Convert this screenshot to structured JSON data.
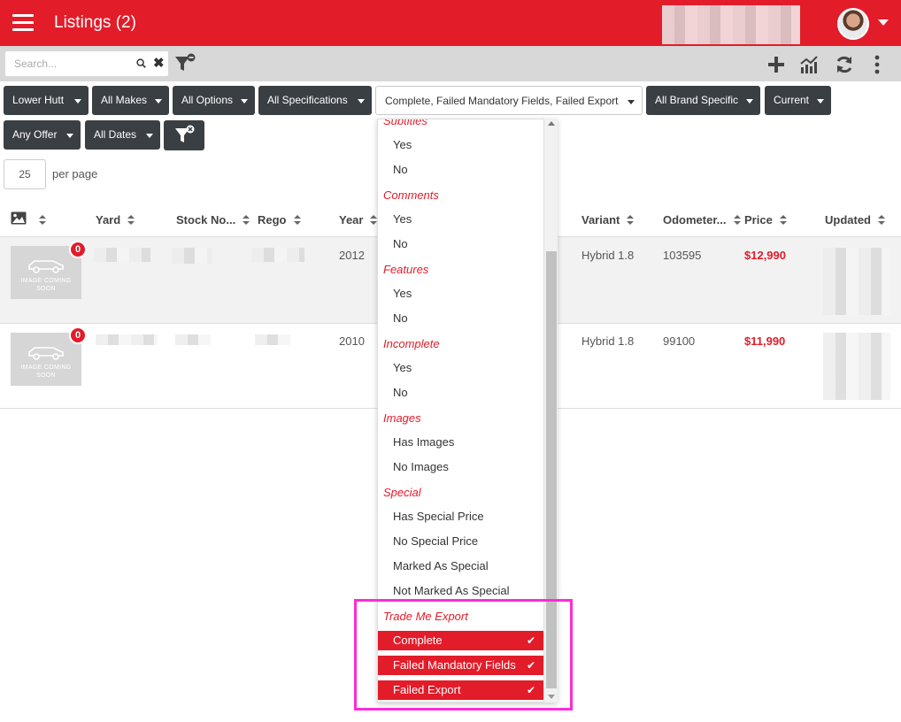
{
  "header": {
    "title": "Listings (2)",
    "accent_color": "#e31c2a"
  },
  "toolbar": {
    "search_placeholder": "Search...",
    "icons": [
      "search-icon",
      "clear-icon",
      "filter-clear-icon",
      "add-icon",
      "stats-icon",
      "refresh-icon",
      "more-vert-icon"
    ]
  },
  "filters": {
    "yard": "Lower Hutt",
    "makes": "All Makes",
    "options": "All Options",
    "specifications": "All Specifications",
    "export_status": "Complete,  Failed Mandatory Fields,  Failed Export",
    "brand_specific": "All Brand Specific",
    "status": "Current",
    "offer": "Any Offer",
    "dates": "All Dates"
  },
  "pagination": {
    "per_page_value": "25",
    "per_page_label": "per page"
  },
  "table": {
    "columns": [
      "Yard",
      "Stock No...",
      "Rego",
      "Year",
      "Variant",
      "Odometer...",
      "Price",
      "Updated"
    ],
    "rows": [
      {
        "badge": "0",
        "image_text": "IMAGE COMING SOON",
        "year": "2012",
        "variant": "Hybrid 1.8",
        "odometer": "103595",
        "price": "$12,990"
      },
      {
        "badge": "0",
        "image_text": "IMAGE COMING SOON",
        "year": "2010",
        "variant": "Hybrid 1.8",
        "odometer": "99100",
        "price": "$11,990"
      }
    ]
  },
  "dropdown": {
    "groups": [
      {
        "label": "Subtitles",
        "items": [
          "Yes",
          "No"
        ]
      },
      {
        "label": "Comments",
        "items": [
          "Yes",
          "No"
        ]
      },
      {
        "label": "Features",
        "items": [
          "Yes",
          "No"
        ]
      },
      {
        "label": "Incomplete",
        "items": [
          "Yes",
          "No"
        ]
      },
      {
        "label": "Images",
        "items": [
          "Has Images",
          "No Images"
        ]
      },
      {
        "label": "Special",
        "items": [
          "Has Special Price",
          "No Special Price",
          "Marked As Special",
          "Not Marked As Special"
        ]
      },
      {
        "label": "Trade Me Export",
        "items": [
          "Complete",
          "Failed Mandatory Fields",
          "Failed Export"
        ]
      }
    ],
    "selected": [
      "Complete",
      "Failed Mandatory Fields",
      "Failed Export"
    ],
    "check_glyph": "✔"
  }
}
